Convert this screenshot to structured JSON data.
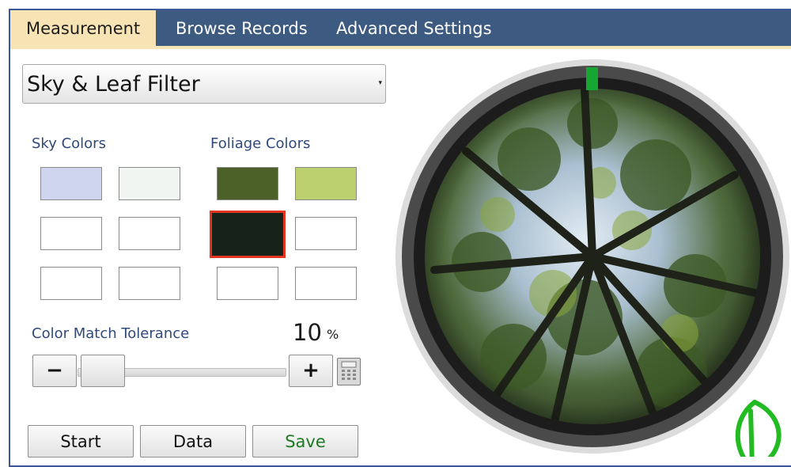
{
  "tabs": [
    {
      "label": "Measurement",
      "active": true
    },
    {
      "label": "Browse Records",
      "active": false
    },
    {
      "label": "Advanced Settings",
      "active": false
    }
  ],
  "filter_dropdown": {
    "selected": "Sky & Leaf Filter"
  },
  "sky_colors": {
    "label": "Sky Colors",
    "swatches": [
      "#cfd5ee",
      "#f1f5f2",
      "#ffffff",
      "#ffffff",
      "#ffffff",
      "#ffffff"
    ]
  },
  "foliage_colors": {
    "label": "Foliage Colors",
    "swatches": [
      "#4b6127",
      "#bdd06f",
      "#172219",
      "#ffffff",
      "#ffffff",
      "#ffffff"
    ],
    "selected_index": 2
  },
  "tolerance": {
    "label": "Color Match Tolerance",
    "value": "10",
    "unit": "%",
    "decrement_label": "−",
    "increment_label": "+",
    "slider_level": 0.1
  },
  "actions": {
    "start": "Start",
    "data": "Data",
    "save": "Save"
  },
  "colors": {
    "tab_bar": "#3d5a80",
    "active_tab": "#f8e3b4",
    "accent_text": "#2f4a7a",
    "save_text": "#1e7a24",
    "selection_border": "#e2341e",
    "logo": "#22bb22"
  },
  "icons": {
    "calculator": "calculator-icon",
    "logo": "leaf-logo-icon",
    "dropdown": "dropdown-arrow-icon"
  }
}
